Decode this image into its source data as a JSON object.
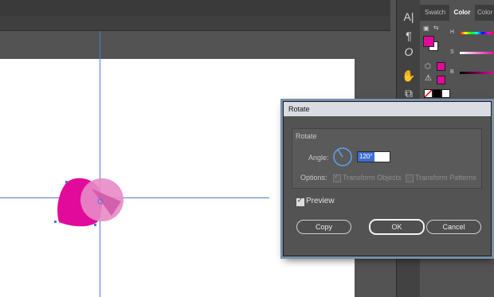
{
  "panels": {
    "tabs": [
      {
        "label": "Swatch"
      },
      {
        "label": "Color"
      },
      {
        "label": "Color"
      }
    ],
    "sliders": [
      {
        "label": "H",
        "gradient": "linear-gradient(90deg,#ff0000,#ffff00,#00ff00,#00ffff,#0000ff,#ff00ff,#ff0000)"
      },
      {
        "label": "S",
        "gradient": "linear-gradient(90deg,#ffffff,#e20a9a)"
      },
      {
        "label": "B",
        "gradient": "linear-gradient(90deg,#000000,#e20a9a)"
      }
    ],
    "fill_color": "#e20a9a",
    "swatches": [
      "#e20a9a",
      "#e20a9a",
      "#e20a9a",
      "#000000",
      "#ffffff"
    ]
  },
  "tools": [
    {
      "name": "character-icon",
      "glyph": "A|"
    },
    {
      "name": "paragraph-icon",
      "glyph": "¶"
    },
    {
      "name": "opentype-icon",
      "glyph": "O"
    },
    {
      "name": "puppet-warp-icon",
      "glyph": "✋"
    },
    {
      "name": "transform-icon",
      "glyph": "⧉"
    }
  ],
  "dialog": {
    "title": "Rotate",
    "group_label": "Rotate",
    "angle_label": "Angle:",
    "angle_value": "120°",
    "options_label": "Options:",
    "transform_objects_label": "Transform Objects",
    "transform_patterns_label": "Transform Patterns",
    "preview_label": "Preview",
    "copy_label": "Copy",
    "ok_label": "OK",
    "cancel_label": "Cancel"
  },
  "colors": {
    "accent_magenta": "#e20a9a",
    "guide_blue": "#4f78d8",
    "selection_blue": "#3c6fd1"
  }
}
